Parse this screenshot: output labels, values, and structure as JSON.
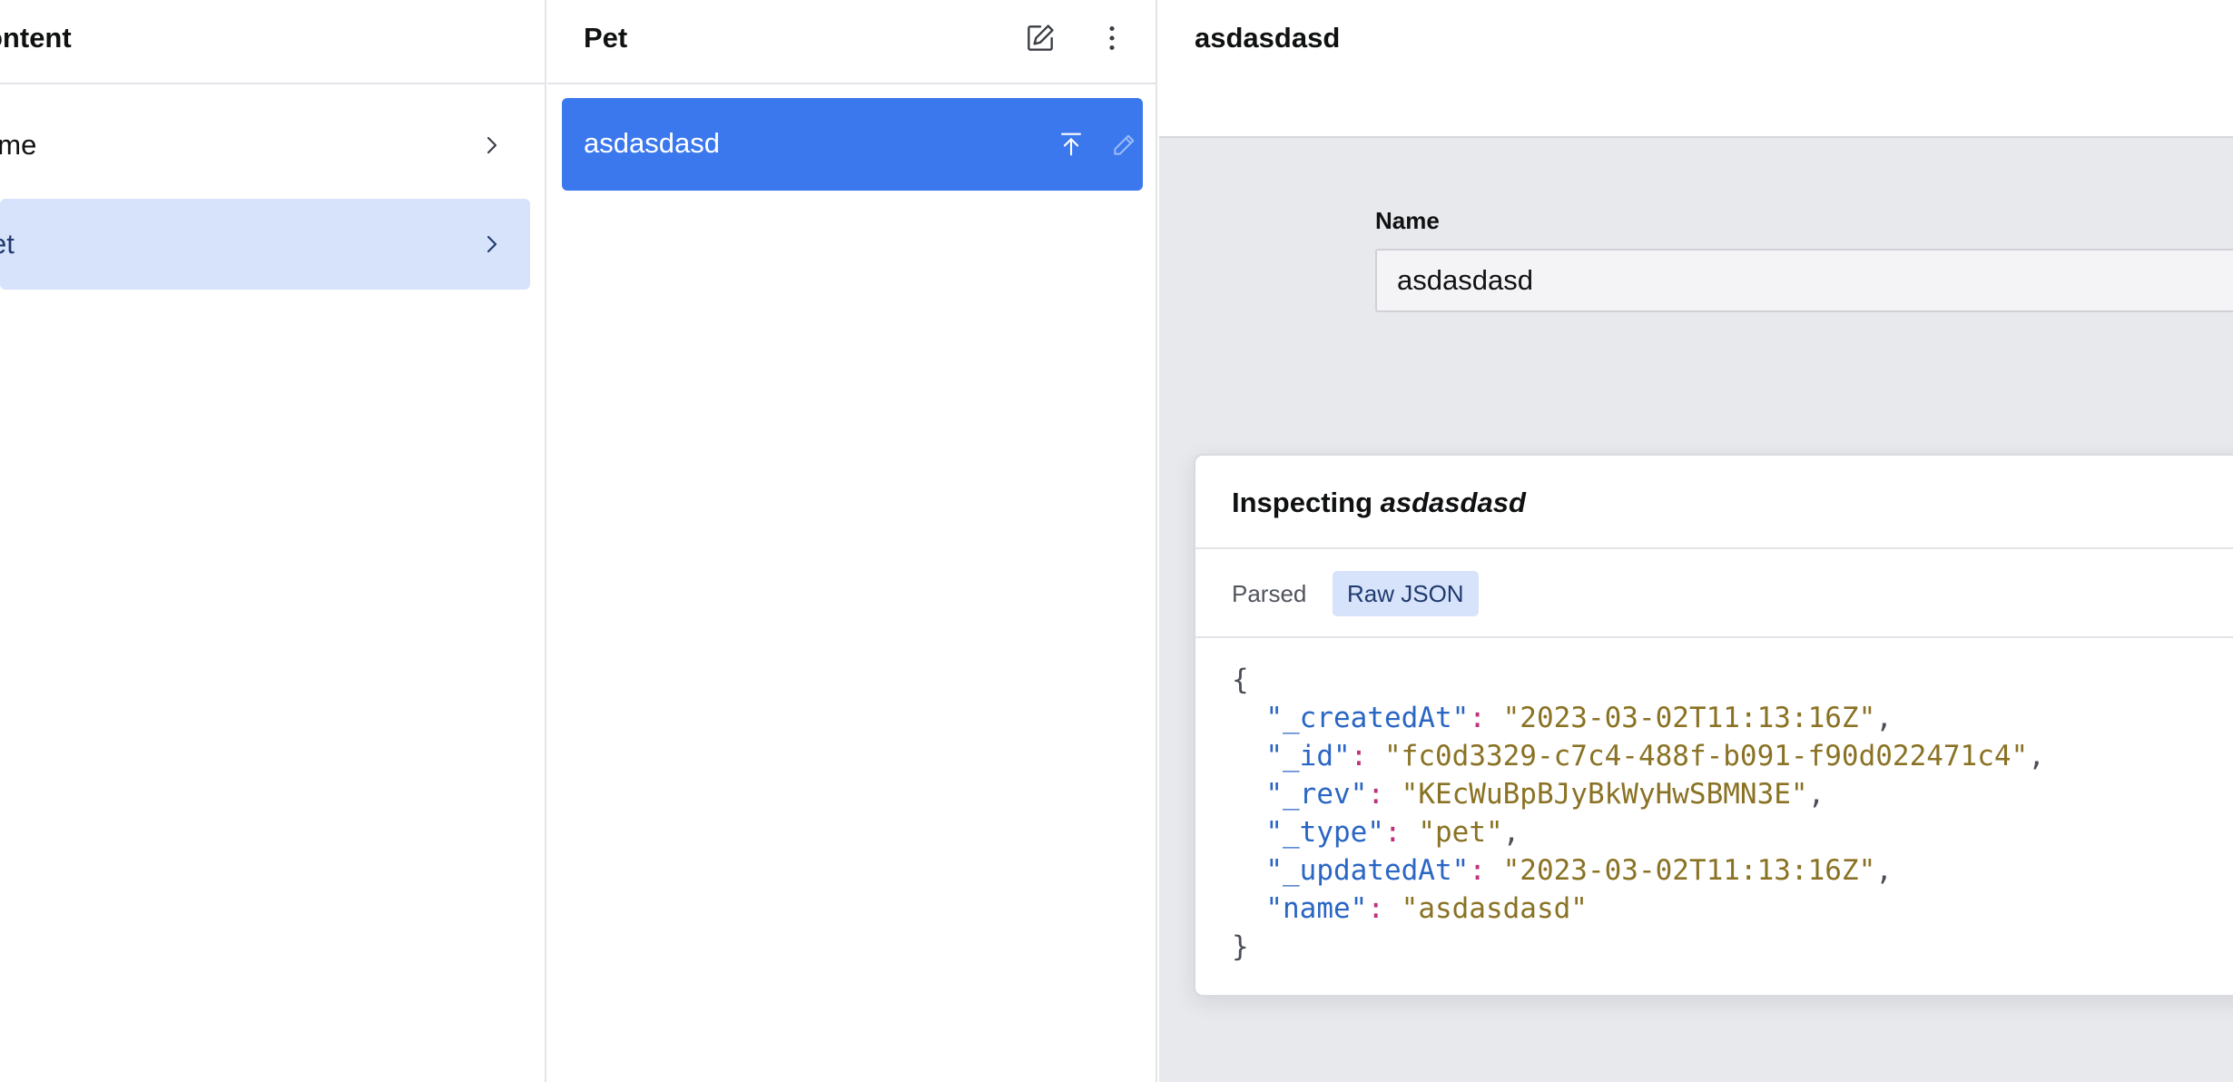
{
  "content_pane": {
    "title": "ontent",
    "items": [
      {
        "label": "ame"
      },
      {
        "label": "et"
      }
    ]
  },
  "pet_pane": {
    "title": "Pet",
    "documents": [
      {
        "label": "asdasdasd"
      }
    ]
  },
  "document_pane": {
    "title": "asdasdasd",
    "field_label": "Name",
    "field_value": "asdasdasd"
  },
  "inspector": {
    "title_prefix": "Inspecting ",
    "title_doc": "asdasdasd",
    "tabs": [
      {
        "label": "Parsed",
        "active": false
      },
      {
        "label": "Raw JSON",
        "active": true
      }
    ],
    "json": {
      "open": "{",
      "close": "}",
      "entries": [
        {
          "key": "\"_createdAt\"",
          "value": "\"2023-03-02T11:13:16Z\"",
          "sep": ","
        },
        {
          "key": "\"_id\"",
          "value": "\"fc0d3329-c7c4-488f-b091-f90d022471c4\"",
          "sep": ","
        },
        {
          "key": "\"_rev\"",
          "value": "\"KEcWuBpBJyBkWyHwSBMN3E\"",
          "sep": ","
        },
        {
          "key": "\"_type\"",
          "value": "\"pet\"",
          "sep": ","
        },
        {
          "key": "\"_updatedAt\"",
          "value": "\"2023-03-02T11:13:16Z\"",
          "sep": ","
        },
        {
          "key": "\"name\"",
          "value": "\"asdasdasd\"",
          "sep": ""
        }
      ]
    }
  },
  "icons": {
    "chevron": "chevron-right-icon",
    "edit": "compose-icon",
    "menu": "ellipsis-vertical-icon",
    "publish": "publish-icon",
    "pencil": "pencil-icon"
  },
  "colors": {
    "selected_bg": "#d7e3fb",
    "primary": "#3b78ee",
    "json_key": "#2a66c4",
    "json_string": "#8a7224",
    "json_punct": "#c0307a"
  }
}
